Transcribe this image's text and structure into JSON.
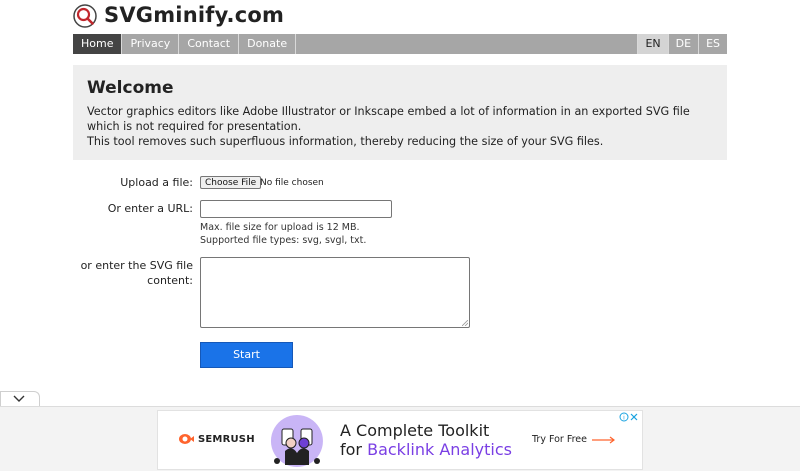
{
  "site": {
    "title": "SVGminify.com",
    "logo_icon": "magnifier-icon"
  },
  "nav": {
    "items": [
      {
        "label": "Home",
        "active": true
      },
      {
        "label": "Privacy",
        "active": false
      },
      {
        "label": "Contact",
        "active": false
      },
      {
        "label": "Donate",
        "active": false
      }
    ],
    "languages": [
      {
        "label": "EN",
        "active": true
      },
      {
        "label": "DE",
        "active": false
      },
      {
        "label": "ES",
        "active": false
      }
    ]
  },
  "welcome": {
    "heading": "Welcome",
    "line1": "Vector graphics editors like Adobe Illustrator or Inkscape embed a lot of information in an exported SVG file which is not required for presentation.",
    "line2": "This tool removes such superfluous information, thereby reducing the size of your SVG files."
  },
  "form": {
    "upload_label": "Upload a file:",
    "choose_file_button": "Choose File",
    "file_status": "No file chosen",
    "url_label": "Or enter a URL:",
    "url_value": "",
    "hint_max_size": "Max. file size for upload is 12 MB.",
    "hint_types": "Supported file types: svg, svgl, txt.",
    "content_label": "or enter the SVG file content:",
    "content_value": "",
    "start_button": "Start"
  },
  "ad": {
    "brand": "SEMRUSH",
    "headline_line1": "A Complete Toolkit",
    "headline_prefix": "for ",
    "headline_accent": "Backlink Analytics",
    "cta": "Try For Free",
    "accent_color": "#7a3fe4",
    "brand_color": "#ff642d"
  },
  "colors": {
    "nav_bg": "#a6a6a6",
    "nav_active_bg": "#444444",
    "welcome_bg": "#eeeeee",
    "start_button_bg": "#1a73e8"
  }
}
